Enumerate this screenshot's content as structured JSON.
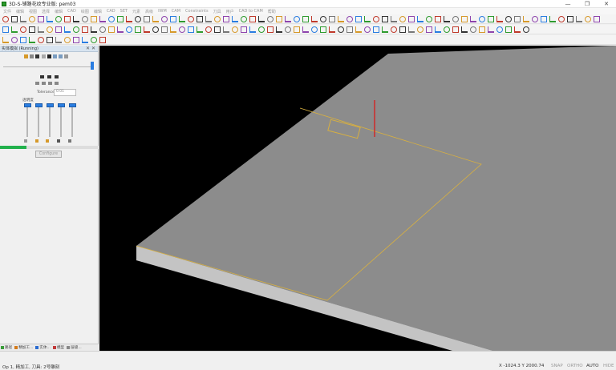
{
  "window": {
    "title": "3D-S-铺路花纹专业版: pem03",
    "buttons": [
      "—",
      "❐",
      "✕"
    ]
  },
  "menubar": {
    "items": [
      "文件",
      "编辑",
      "视图",
      "选择",
      "编辑",
      "CAD",
      "绘图",
      "编辑",
      "CAD",
      "SET",
      "元素",
      "高级",
      "IWM",
      "CAM",
      "Constraints",
      "刀具",
      "用户",
      "CAD to CAM",
      "帮助"
    ]
  },
  "sidepanel": {
    "title": "实体模拟 (Running)",
    "close_glyph": "✕ ✕",
    "tolerance_label": "Tolerance",
    "tolerance_value": "0.01",
    "transparency_label": "透明度",
    "configure_label": "Configure",
    "progress_fraction": 0.27,
    "sliders": [
      {
        "name": "slider-1",
        "level": 0.0
      },
      {
        "name": "slider-2",
        "level": 0.0
      },
      {
        "name": "slider-3",
        "level": 0.0
      },
      {
        "name": "slider-4",
        "level": 0.0
      },
      {
        "name": "slider-5",
        "level": 0.0
      }
    ]
  },
  "bottom_tabs": [
    {
      "label": "路径",
      "color": "#3a9d3a"
    },
    {
      "label": "精加工...",
      "color": "#d47a1a"
    },
    {
      "label": "实体...",
      "color": "#2a6bd1"
    },
    {
      "label": "模型",
      "color": "#c23a3a"
    },
    {
      "label": "层级...",
      "color": "#888888"
    }
  ],
  "statusbar": {
    "op_text": "Op 1, 精加工, 刀具: 2号雕刻",
    "coords": "X -1024.3   Y 2000.74",
    "snap": "SNAP",
    "ortho": "ORTHO",
    "auto": "AUTO",
    "hide": "HIDE"
  },
  "colors": {
    "viewport_bg": "#000000",
    "plane": "#8c8c8c",
    "plane_edge": "#c8c8c8",
    "toolpath": "#d8b040",
    "tool_axis": "#e01010",
    "accent": "#2a7de1",
    "progress": "#22b14c"
  }
}
